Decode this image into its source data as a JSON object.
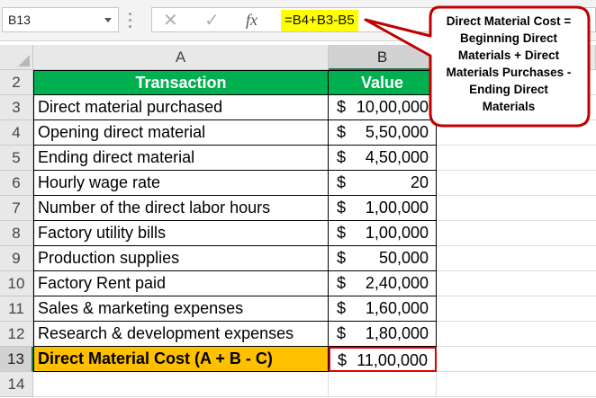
{
  "formula_bar": {
    "name_box": "B13",
    "cancel_glyph": "✕",
    "enter_glyph": "✓",
    "fx_label": "fx",
    "formula": "=B4+B3-B5"
  },
  "columns": {
    "a": "A",
    "b": "B"
  },
  "rows": [
    {
      "num": "2",
      "label": "Transaction",
      "currency": "",
      "value": "Value"
    },
    {
      "num": "3",
      "label": "Direct material purchased",
      "currency": "$",
      "value": "10,00,000"
    },
    {
      "num": "4",
      "label": "Opening direct material",
      "currency": "$",
      "value": "5,50,000"
    },
    {
      "num": "5",
      "label": "Ending direct material",
      "currency": "$",
      "value": "4,50,000"
    },
    {
      "num": "6",
      "label": "Hourly wage rate",
      "currency": "$",
      "value": "20"
    },
    {
      "num": "7",
      "label": "Number of the direct labor hours",
      "currency": "$",
      "value": "1,00,000"
    },
    {
      "num": "8",
      "label": "Factory utility bills",
      "currency": "$",
      "value": "1,00,000"
    },
    {
      "num": "9",
      "label": "Production supplies",
      "currency": "$",
      "value": "50,000"
    },
    {
      "num": "10",
      "label": "Factory Rent paid",
      "currency": "$",
      "value": "2,40,000"
    },
    {
      "num": "11",
      "label": "Sales & marketing expenses",
      "currency": "$",
      "value": "1,60,000"
    },
    {
      "num": "12",
      "label": "Research & development expenses",
      "currency": "$",
      "value": "1,80,000"
    },
    {
      "num": "13",
      "label": "Direct Material Cost (A + B - C)",
      "currency": "$",
      "value": "11,00,000"
    },
    {
      "num": "14",
      "label": "",
      "currency": "",
      "value": ""
    }
  ],
  "callout": {
    "lines": [
      "Direct Material Cost =",
      "Beginning Direct",
      "Materials + Direct",
      "Materials Purchases -",
      "Ending Direct",
      "Materials"
    ]
  },
  "colors": {
    "header_fill": "#00b050",
    "total_fill": "#ffc000",
    "formula_highlight": "#ffff00",
    "callout_border": "#c00000",
    "selection_border": "#e00000"
  }
}
